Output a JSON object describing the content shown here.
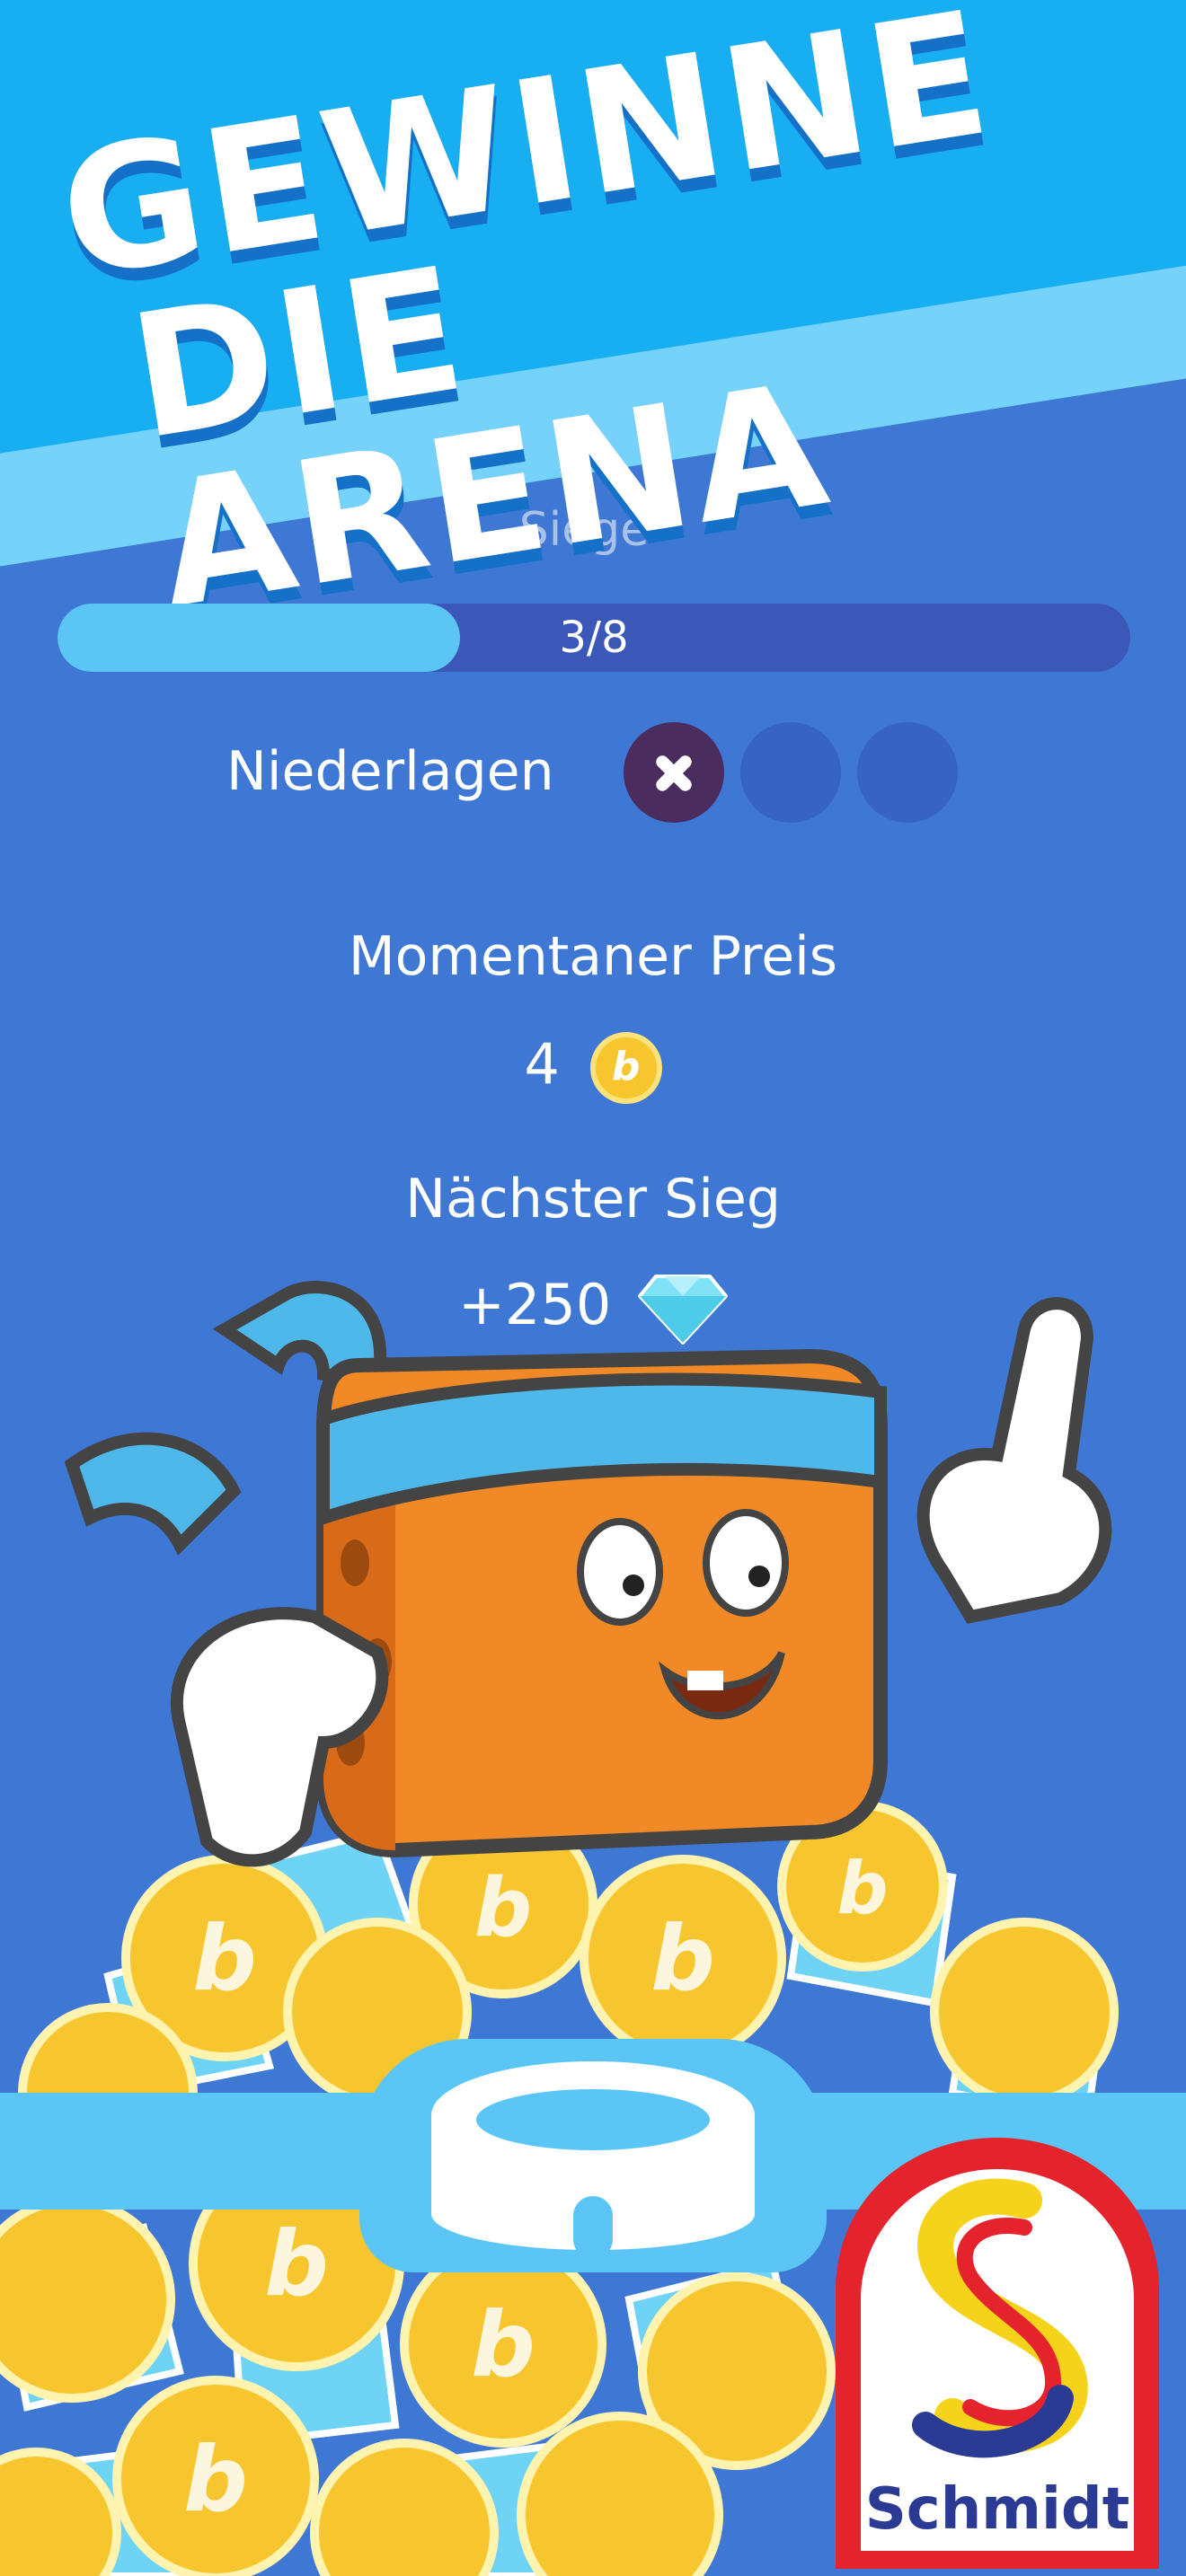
{
  "promo": {
    "line1": "GEWINNE",
    "line2": "DIE ARENA"
  },
  "wins": {
    "label": "Siege",
    "progress_text": "3/8",
    "current": 3,
    "total": 8
  },
  "losses": {
    "label": "Niederlagen",
    "count": 1,
    "max": 3
  },
  "current_prize": {
    "label": "Momentaner Preis",
    "value": "4",
    "currency_icon": "coin-icon"
  },
  "next_win": {
    "label": "Nächster Sieg",
    "value": "+250",
    "reward_icon": "diamond-icon"
  },
  "nav": {
    "arena_icon": "arena-stadium-icon"
  },
  "brand": {
    "name": "Schmidt"
  },
  "colors": {
    "background": "#3E78D4",
    "accent": "#5BC6F6",
    "banner": "#18AEF2",
    "coin": "#F7C62E"
  }
}
